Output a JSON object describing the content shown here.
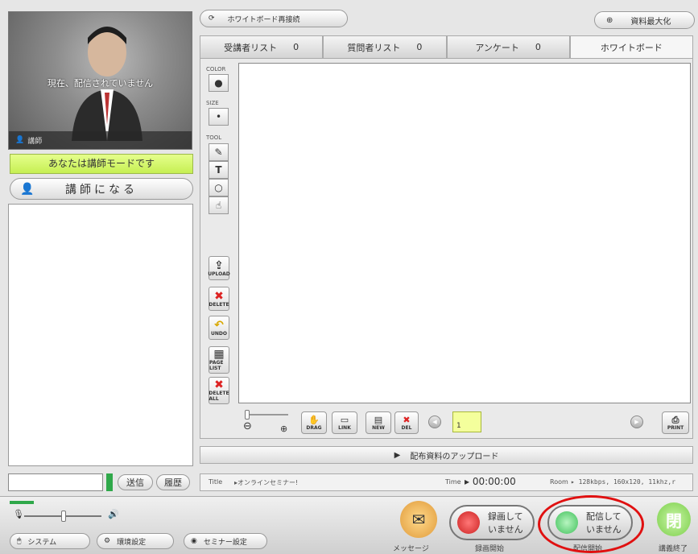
{
  "video": {
    "status": "現在、配信されていません",
    "role_label": "講師"
  },
  "mode_banner": "あなたは講師モードです",
  "become_button": "講師になる",
  "chat": {
    "send": "送信",
    "history": "履歴"
  },
  "top": {
    "reconnect": "ホワイトボード再接続",
    "maximize": "資料最大化"
  },
  "tabs": [
    {
      "label": "受講者リスト",
      "count": "0"
    },
    {
      "label": "質問者リスト",
      "count": "0"
    },
    {
      "label": "アンケート",
      "count": "0"
    },
    {
      "label": "ホワイトボード",
      "count": ""
    }
  ],
  "tools": {
    "color": "COLOR",
    "size": "SIZE",
    "tool": "TOOL",
    "upload": "UPLOAD",
    "delete": "DELETE",
    "undo": "UNDO",
    "page_list": "PAGE LIST",
    "delete_all": "DELETE ALL"
  },
  "toolbar": {
    "drag": "DRAG",
    "link": "LINK",
    "new": "NEW",
    "del": "DEL",
    "page": "1",
    "print": "PRINT"
  },
  "upload_bar": "配布資料のアップロード",
  "info": {
    "title_label": "Title",
    "title_value": "▸オンラインセミナー!",
    "time_label": "Time",
    "time_value": "▸ 00:00:00",
    "room_label": "Room",
    "room_value": "▸ 128kbps, 160x120, 11khz,r"
  },
  "bottom": {
    "system": "システム",
    "env": "環境設定",
    "seminar": "セミナー設定",
    "message": "メッセージ",
    "record_state": "録画して\nいません",
    "record_caption": "録画開始",
    "broadcast_state": "配信して\nいません",
    "broadcast_caption": "配信開始",
    "end_caption": "講義終了",
    "end_glyph": "閉"
  }
}
